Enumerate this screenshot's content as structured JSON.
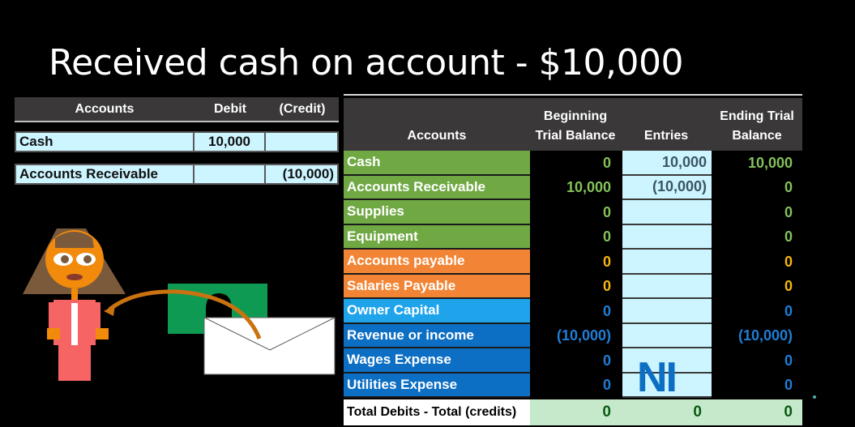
{
  "slide": {
    "title": "Received cash on account - $10,000"
  },
  "journal_entry": {
    "headers": {
      "accounts": "Accounts",
      "debit": "Debit",
      "credit": "(Credit)"
    },
    "rows": [
      {
        "account": "Cash",
        "debit": "10,000",
        "credit": ""
      },
      {
        "account": "Accounts Receivable",
        "debit": "",
        "credit": "(10,000)"
      }
    ]
  },
  "trial_balance": {
    "headers": {
      "accounts": "Accounts",
      "beginning_line1": "Beginning",
      "beginning_line2": "Trial Balance",
      "entries": "Entries",
      "ending_line1": "Ending Trial",
      "ending_line2": "Balance"
    },
    "rows": [
      {
        "account": "Cash",
        "group": "asset",
        "beginning": "0",
        "entries": "10,000",
        "ending": "10,000"
      },
      {
        "account": "Accounts Receivable",
        "group": "asset",
        "beginning": "10,000",
        "entries": "(10,000)",
        "ending": "0"
      },
      {
        "account": "Supplies",
        "group": "asset",
        "beginning": "0",
        "entries": "",
        "ending": "0"
      },
      {
        "account": "Equipment",
        "group": "asset",
        "beginning": "0",
        "entries": "",
        "ending": "0"
      },
      {
        "account": "Accounts payable",
        "group": "liability",
        "beginning": "0",
        "entries": "",
        "ending": "0"
      },
      {
        "account": "Salaries Payable",
        "group": "liability",
        "beginning": "0",
        "entries": "",
        "ending": "0"
      },
      {
        "account": "Owner Capital",
        "group": "equity",
        "beginning": "0",
        "entries": "",
        "ending": "0"
      },
      {
        "account": "Revenue or income",
        "group": "income",
        "beginning": "(10,000)",
        "entries": "",
        "ending": "(10,000)"
      },
      {
        "account": "Wages Expense",
        "group": "income",
        "beginning": "0",
        "entries": "",
        "ending": "0"
      },
      {
        "account": "Utilities Expense",
        "group": "income",
        "beginning": "0",
        "entries": "",
        "ending": "0"
      }
    ],
    "total": {
      "label": "Total Debits - Total (credits)",
      "beginning": "0",
      "entries": "0",
      "ending": "0"
    },
    "ni_label": "NI"
  },
  "colors": {
    "asset": "#70a944",
    "liability": "#f28535",
    "equity": "#1fa4ec",
    "income": "#0d6fc4",
    "entries_cell": "#cdf5ff",
    "total_row": "#c6e9cc"
  }
}
